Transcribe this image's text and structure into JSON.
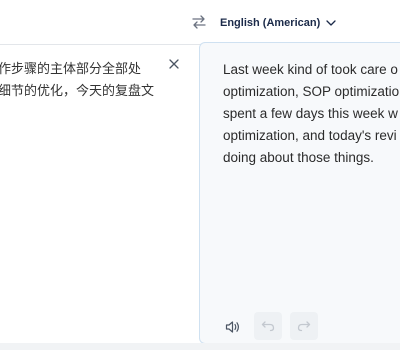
{
  "header": {
    "target_language": "English (American)",
    "icons": {
      "swap": "swap-arrows-icon",
      "dropdown": "chevron-down-icon"
    }
  },
  "source": {
    "lines": [
      "作步骤的主体部分全部处",
      "细节的优化，今天的复盘文"
    ],
    "icons": {
      "clear": "close-icon"
    }
  },
  "target": {
    "lines": [
      "Last week kind of took care o",
      "optimization, SOP optimizatio",
      "spent a few days this week w",
      "optimization, and today's revi",
      "doing about those things."
    ],
    "icons": {
      "listen": "speaker-icon",
      "undo": "undo-icon",
      "redo": "redo-icon"
    }
  },
  "colors": {
    "accent_text": "#1b2a49",
    "target_pane_bg": "#f7f9fb",
    "target_pane_border": "#cfe1f1"
  }
}
